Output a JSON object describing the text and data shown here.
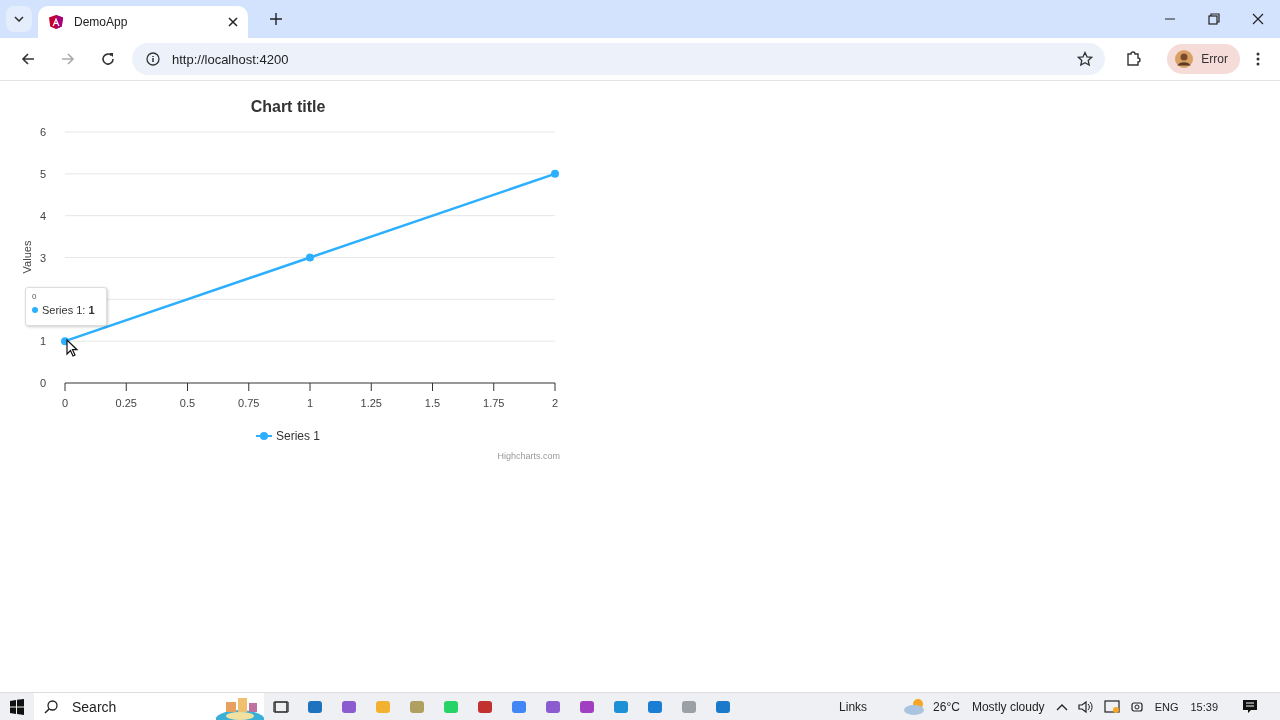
{
  "browser": {
    "tabs": [
      {
        "title": "DemoApp",
        "selected": true
      }
    ],
    "url": "http://localhost:4200",
    "profile_label": "Error"
  },
  "chart": {
    "chart_data": {
      "type": "line",
      "title": "Chart title",
      "ylabel": "Values",
      "x": [
        0,
        1,
        2
      ],
      "series": [
        {
          "name": "Series 1",
          "color": "#2caffe",
          "values": [
            1,
            3,
            5
          ]
        }
      ],
      "xlim": [
        0,
        2
      ],
      "ylim": [
        0,
        6
      ],
      "xticks": [
        0,
        0.25,
        0.5,
        0.75,
        1,
        1.25,
        1.5,
        1.75,
        2
      ],
      "yticks": [
        0,
        1,
        3,
        4,
        5,
        6
      ],
      "grid": true,
      "marker": true
    },
    "tooltip": {
      "header": "0",
      "text": "Series 1: **1**"
    },
    "credits": "Highcharts.com"
  },
  "taskbar": {
    "search_placeholder": "Search",
    "links": "Links",
    "temperature": "26°C",
    "weather": "Mostly cloudy",
    "language": "ENG",
    "time": "15:39"
  }
}
